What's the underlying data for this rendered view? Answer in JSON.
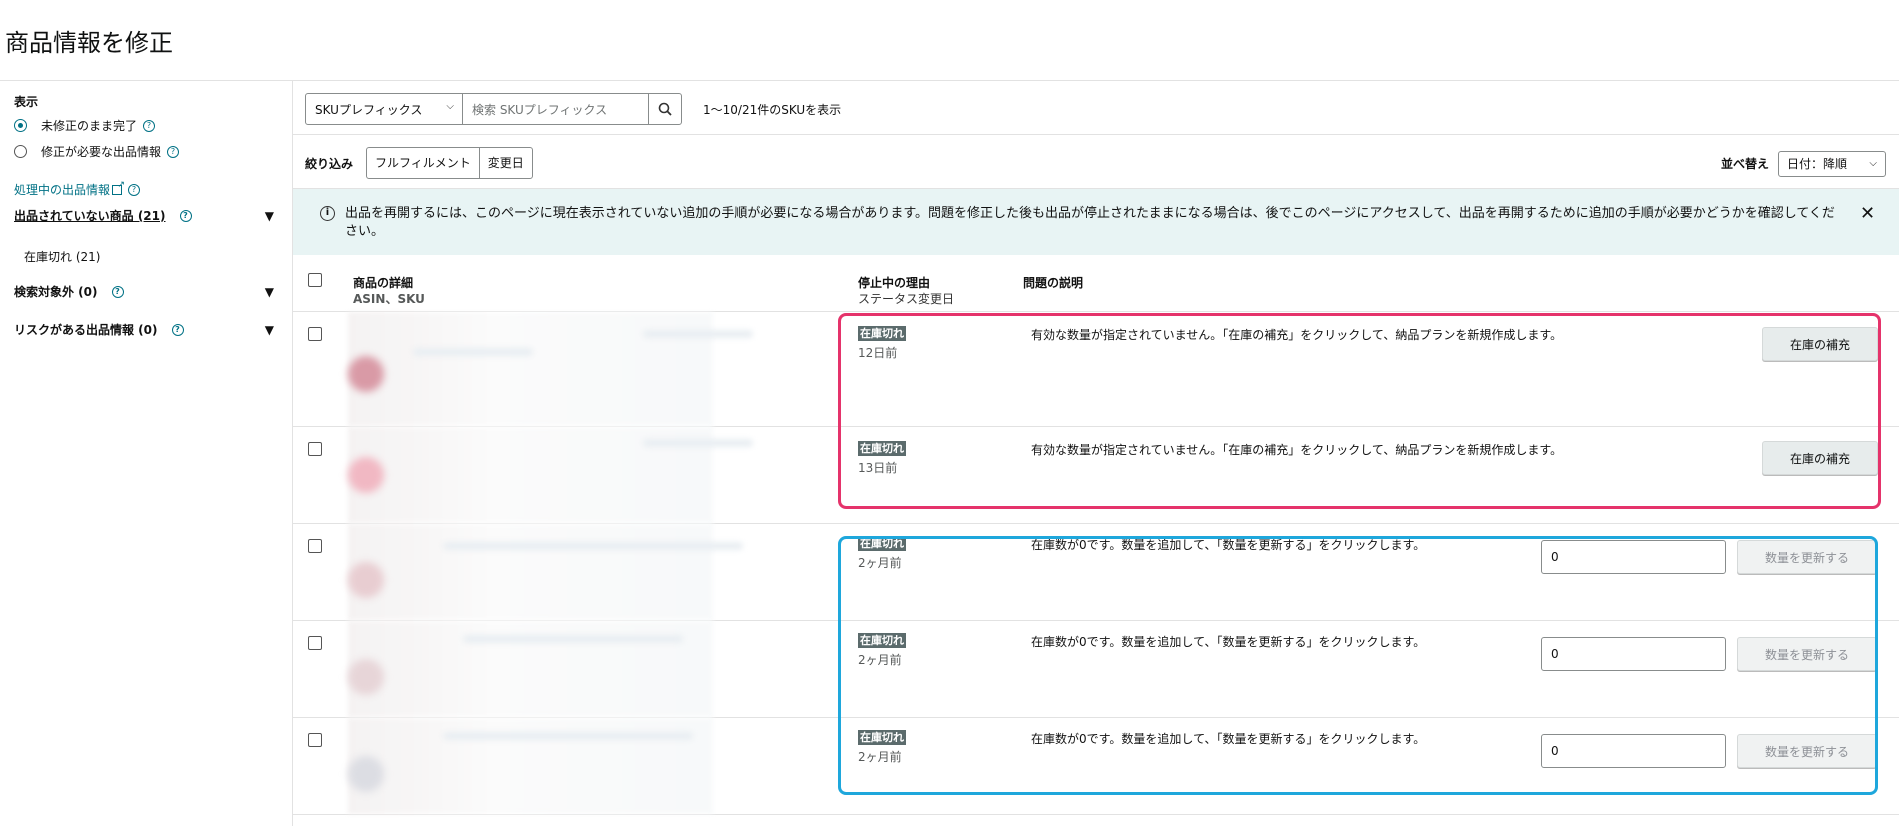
{
  "header": {
    "title": "商品情報を修正"
  },
  "sidebar": {
    "display_title": "表示",
    "radio_options": [
      {
        "label": "未修正のまま完了",
        "selected": true
      },
      {
        "label": "修正が必要な出品情報",
        "selected": false
      }
    ],
    "processing_link": "処理中の出品情報",
    "sections": [
      {
        "label": "出品されていない商品 (21)",
        "sub_items": [
          "在庫切れ (21)"
        ]
      },
      {
        "label": "検索対象外 (0)"
      },
      {
        "label": "リスクがある出品情報 (0)"
      }
    ]
  },
  "toolbar": {
    "sku_select": "SKUプレフィックス",
    "search_placeholder": "検索 SKUプレフィックス",
    "count_text": "1〜10/21件のSKUを表示"
  },
  "filters": {
    "label": "絞り込み",
    "chips": [
      "フルフィルメント",
      "変更日"
    ],
    "sort_label": "並べ替え",
    "sort_value": "日付：降順"
  },
  "banner": {
    "message": "出品を再開するには、このページに現在表示されていない追加の手順が必要になる場合があります。問題を修正した後も出品が停止されたままになる場合は、後でこのページにアクセスして、出品を再開するために追加の手順が必要かどうかを確認してください。",
    "close": "✕"
  },
  "table": {
    "headers": {
      "product": "商品の詳細",
      "product_sub": "ASIN、SKU",
      "reason": "停止中の理由",
      "reason_sub": "ステータス変更日",
      "issue": "問題の説明"
    },
    "rows": [
      {
        "reason": "在庫切れ",
        "ago": "12日前",
        "desc": "有効な数量が指定されていません。「在庫の補充」をクリックして、納品プランを新規作成します。",
        "action": "在庫の補充"
      },
      {
        "reason": "在庫切れ",
        "ago": "13日前",
        "desc": "有効な数量が指定されていません。「在庫の補充」をクリックして、納品プランを新規作成します。",
        "action": "在庫の補充"
      },
      {
        "reason": "在庫切れ",
        "ago": "2ヶ月前",
        "desc": "在庫数が0です。数量を追加して、「数量を更新する」をクリックします。",
        "qty": "0",
        "action": "数量を更新する"
      },
      {
        "reason": "在庫切れ",
        "ago": "2ヶ月前",
        "desc": "在庫数が0です。数量を追加して、「数量を更新する」をクリックします。",
        "qty": "0",
        "action": "数量を更新する"
      },
      {
        "reason": "在庫切れ",
        "ago": "2ヶ月前",
        "desc": "在庫数が0です。数量を追加して、「数量を更新する」をクリックします。",
        "qty": "0",
        "action": "数量を更新する"
      }
    ]
  },
  "colors": {
    "accent": "#007185",
    "highlight_red": "#e5336b",
    "highlight_blue": "#1ea7dc",
    "banner_bg": "#e8f4f4"
  }
}
